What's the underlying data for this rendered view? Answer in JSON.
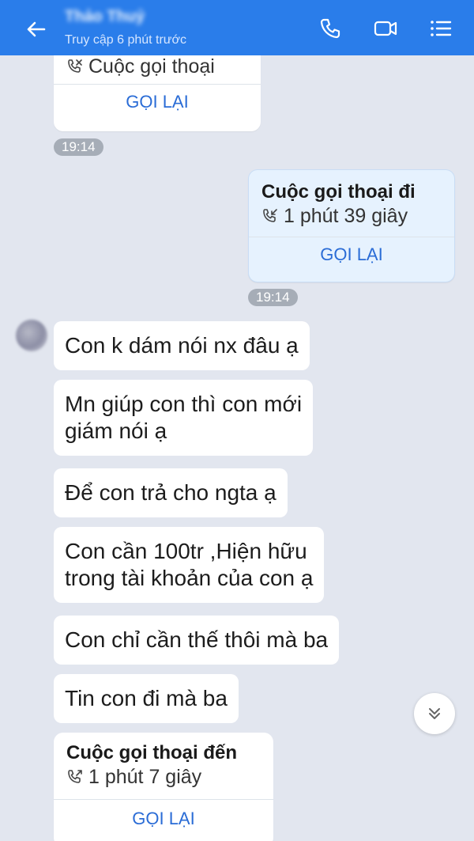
{
  "header": {
    "contact_name": "Thảo Thuỷ",
    "status": "Truy cập 6 phút trước"
  },
  "messages": {
    "call_in_top": {
      "duration": "Cuộc gọi thoại",
      "recall": "GỌI LẠI"
    },
    "time_1": "19:14",
    "call_out": {
      "title": "Cuộc gọi thoại đi",
      "duration": "1 phút 39 giây",
      "recall": "GỌI LẠI"
    },
    "time_2": "19:14",
    "texts": [
      {
        "text": "Con k dám nói nx đâu ạ"
      },
      {
        "text": "Mn giúp con thì con mới\ngiám nói ạ"
      },
      {
        "text": "Để con trả cho ngta ạ"
      },
      {
        "text": "Con cần 100tr ,Hiện hữu\ntrong tài khoản của con ạ"
      },
      {
        "text": "Con chỉ cần thế thôi mà ba"
      },
      {
        "text": "Tin con đi mà ba"
      }
    ],
    "call_in": {
      "title": "Cuộc gọi thoại đến",
      "duration": "1 phút 7 giây",
      "recall": "GỌI LẠI"
    }
  },
  "icons": {
    "back": "arrow-left-icon",
    "call": "phone-icon",
    "video": "video-camera-icon",
    "menu": "menu-list-icon",
    "scroll_down": "double-chevron-down-icon",
    "call_status": "phone-call-icon"
  },
  "colors": {
    "header": "#2a7dea",
    "background": "#e2e6ef",
    "recall_text": "#2a6cd6",
    "outgoing_bubble": "#e6f2fe"
  }
}
